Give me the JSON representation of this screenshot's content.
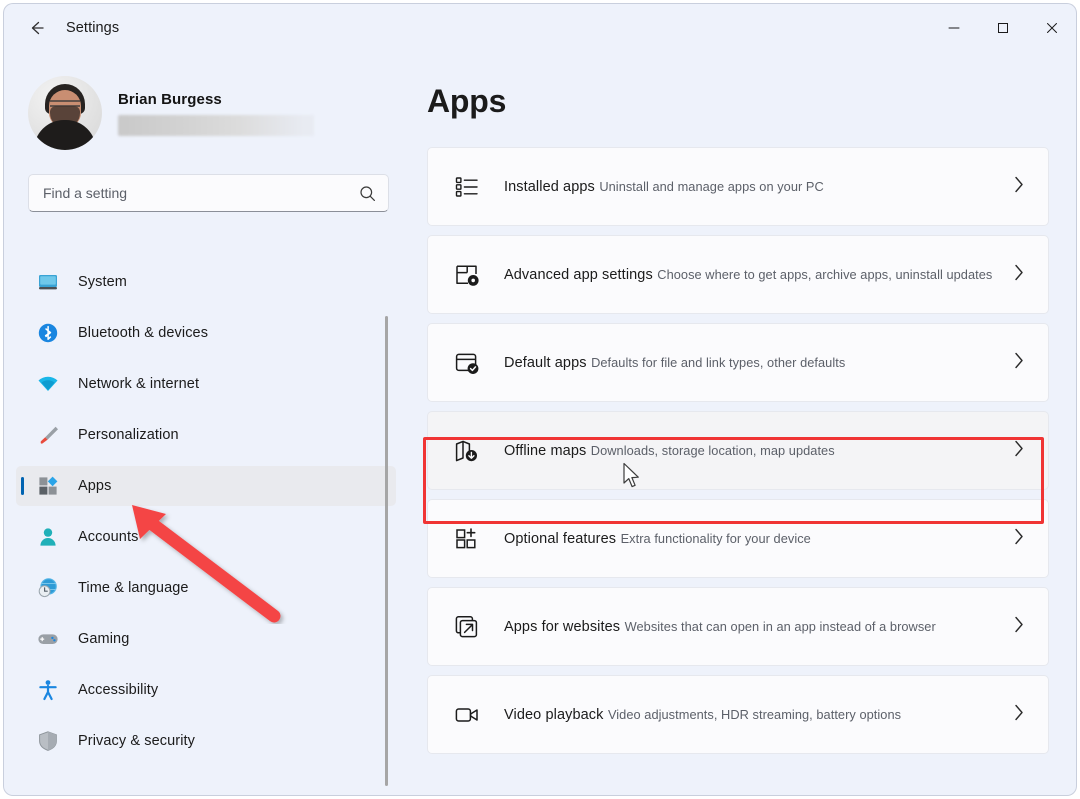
{
  "window": {
    "title": "Settings",
    "back_icon": "back-arrow-icon",
    "controls": [
      {
        "name": "minimize",
        "glyph": "—"
      },
      {
        "name": "maximize",
        "glyph": "□"
      },
      {
        "name": "close",
        "glyph": "✕"
      }
    ]
  },
  "sidebar": {
    "account": {
      "name": "Brian Burgess",
      "email_redacted": true,
      "avatar_icon": "user-avatar-photo"
    },
    "search": {
      "placeholder": "Find a setting",
      "value": "",
      "icon": "search-icon"
    },
    "items": [
      {
        "label": "System",
        "icon": "system-icon",
        "selected": false
      },
      {
        "label": "Bluetooth & devices",
        "icon": "bluetooth-icon",
        "selected": false
      },
      {
        "label": "Network & internet",
        "icon": "network-icon",
        "selected": false
      },
      {
        "label": "Personalization",
        "icon": "personalization-icon",
        "selected": false
      },
      {
        "label": "Apps",
        "icon": "apps-icon",
        "selected": true
      },
      {
        "label": "Accounts",
        "icon": "accounts-icon",
        "selected": false
      },
      {
        "label": "Time & language",
        "icon": "time-language-icon",
        "selected": false
      },
      {
        "label": "Gaming",
        "icon": "gaming-icon",
        "selected": false
      },
      {
        "label": "Accessibility",
        "icon": "accessibility-icon",
        "selected": false
      },
      {
        "label": "Privacy & security",
        "icon": "privacy-security-icon",
        "selected": false
      }
    ]
  },
  "main": {
    "heading": "Apps",
    "cards": [
      {
        "title": "Installed apps",
        "subtitle": "Uninstall and manage apps on your PC",
        "icon": "installed-apps-icon",
        "highlighted": false
      },
      {
        "title": "Advanced app settings",
        "subtitle": "Choose where to get apps, archive apps, uninstall updates",
        "icon": "advanced-app-settings-icon",
        "highlighted": false
      },
      {
        "title": "Default apps",
        "subtitle": "Defaults for file and link types, other defaults",
        "icon": "default-apps-icon",
        "highlighted": false
      },
      {
        "title": "Offline maps",
        "subtitle": "Downloads, storage location, map updates",
        "icon": "offline-maps-icon",
        "highlighted": true
      },
      {
        "title": "Optional features",
        "subtitle": "Extra functionality for your device",
        "icon": "optional-features-icon",
        "highlighted": false
      },
      {
        "title": "Apps for websites",
        "subtitle": "Websites that can open in an app instead of a browser",
        "icon": "apps-for-websites-icon",
        "highlighted": false
      },
      {
        "title": "Video playback",
        "subtitle": "Video adjustments, HDR streaming, battery options",
        "icon": "video-playback-icon",
        "highlighted": false
      }
    ],
    "chevron_glyph": "›"
  },
  "annotations": {
    "highlight_color": "#f03434",
    "arrow_color": "#f44545",
    "highlight_target": "Offline maps",
    "arrow_target": "Apps"
  },
  "colors": {
    "accent": "#0063b1",
    "window_bg": "#eef2fb",
    "card_bg": "#fbfbfd",
    "text_primary": "#1b1b1b",
    "text_secondary": "#5c6069"
  }
}
